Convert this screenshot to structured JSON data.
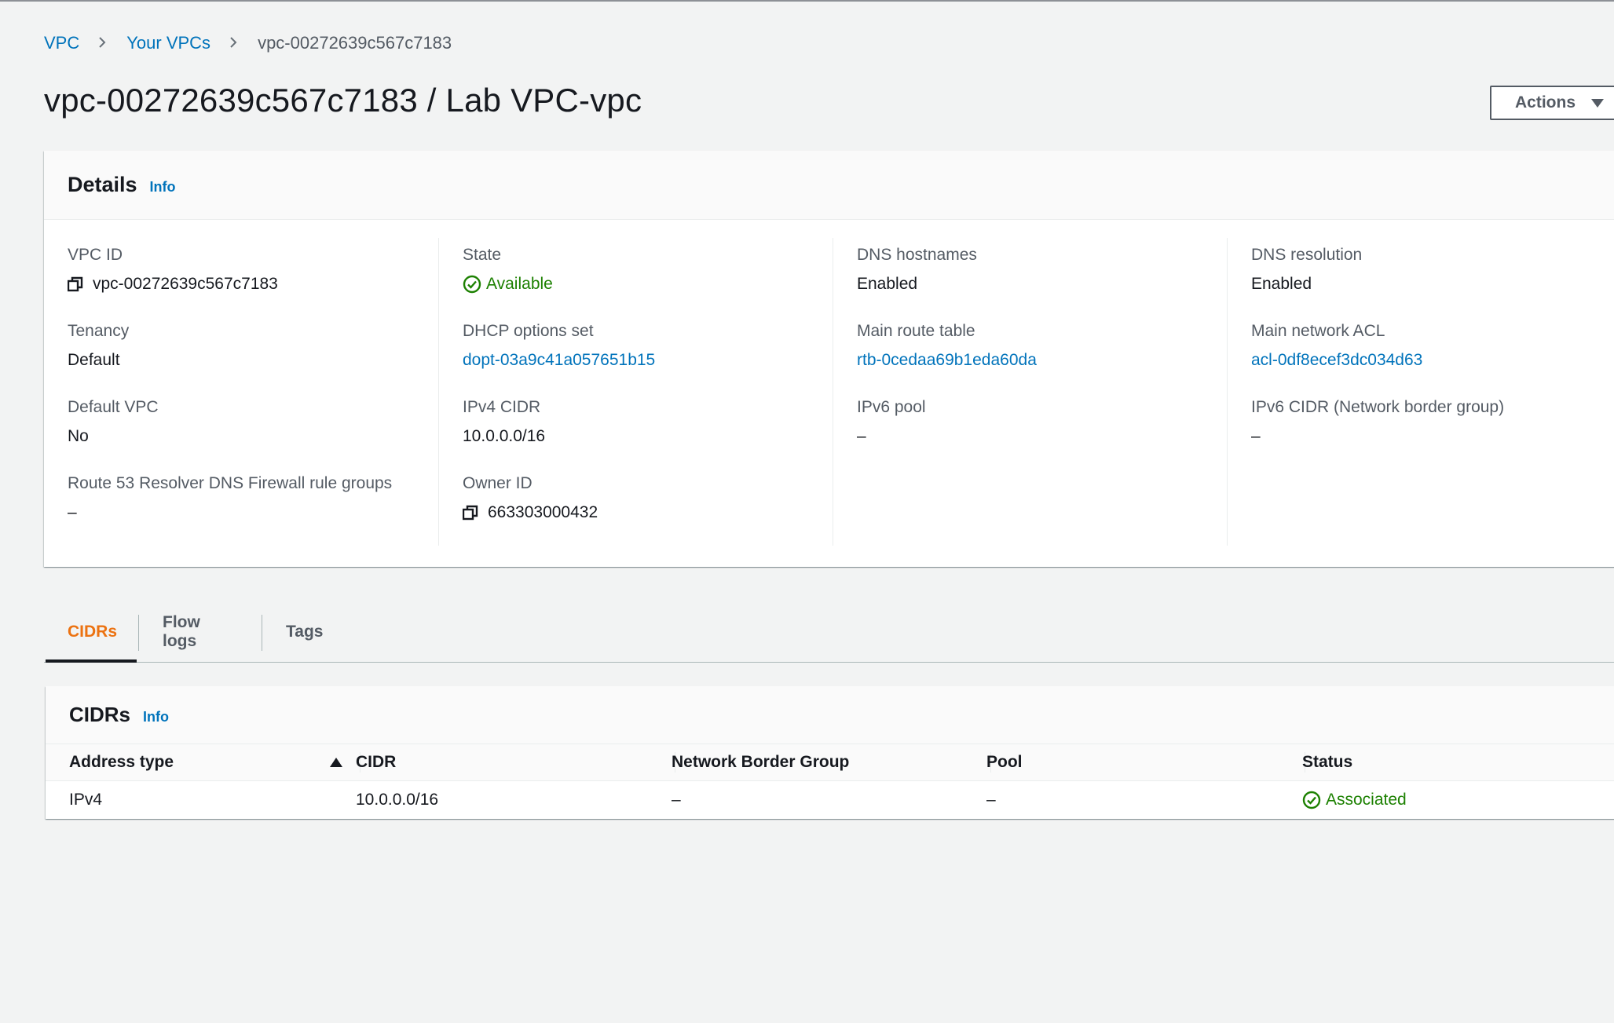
{
  "breadcrumb": {
    "items": [
      "VPC",
      "Your VPCs"
    ],
    "current": "vpc-00272639c567c7183"
  },
  "page": {
    "title": "vpc-00272639c567c7183 / Lab VPC-vpc",
    "actions_label": "Actions"
  },
  "details": {
    "heading": "Details",
    "info_label": "Info",
    "fields": {
      "vpc_id": {
        "label": "VPC ID",
        "value": "vpc-00272639c567c7183"
      },
      "tenancy": {
        "label": "Tenancy",
        "value": "Default"
      },
      "default_vpc": {
        "label": "Default VPC",
        "value": "No"
      },
      "resolver": {
        "label": "Route 53 Resolver DNS Firewall rule groups",
        "value": "–"
      },
      "state": {
        "label": "State",
        "value": "Available"
      },
      "dhcp": {
        "label": "DHCP options set",
        "value": "dopt-03a9c41a057651b15"
      },
      "ipv4_cidr": {
        "label": "IPv4 CIDR",
        "value": "10.0.0.0/16"
      },
      "owner_id": {
        "label": "Owner ID",
        "value": "663303000432"
      },
      "dns_hostnames": {
        "label": "DNS hostnames",
        "value": "Enabled"
      },
      "main_route_table": {
        "label": "Main route table",
        "value": "rtb-0cedaa69b1eda60da"
      },
      "ipv6_pool": {
        "label": "IPv6 pool",
        "value": "–"
      },
      "dns_resolution": {
        "label": "DNS resolution",
        "value": "Enabled"
      },
      "main_acl": {
        "label": "Main network ACL",
        "value": "acl-0df8ecef3dc034d63"
      },
      "ipv6_cidr": {
        "label": "IPv6 CIDR (Network border group)",
        "value": "–"
      }
    }
  },
  "tabs": [
    {
      "label": "CIDRs",
      "active": true
    },
    {
      "label": "Flow logs",
      "active": false
    },
    {
      "label": "Tags",
      "active": false
    }
  ],
  "cidrs": {
    "heading": "CIDRs",
    "info_label": "Info",
    "columns": [
      "Address type",
      "CIDR",
      "Network Border Group",
      "Pool",
      "Status"
    ],
    "rows": [
      [
        "IPv4",
        "10.0.0.0/16",
        "–",
        "–",
        "Associated"
      ]
    ]
  },
  "colors": {
    "link": "#0073bb",
    "success": "#1d8102",
    "active_tab": "#ec7211"
  },
  "icons": {
    "copy": "copy-icon",
    "status_ok": "check-circle-icon",
    "breadcrumb_sep": "chevron-right-icon",
    "dropdown": "caret-down-icon",
    "sort": "sort-ascending-icon"
  }
}
